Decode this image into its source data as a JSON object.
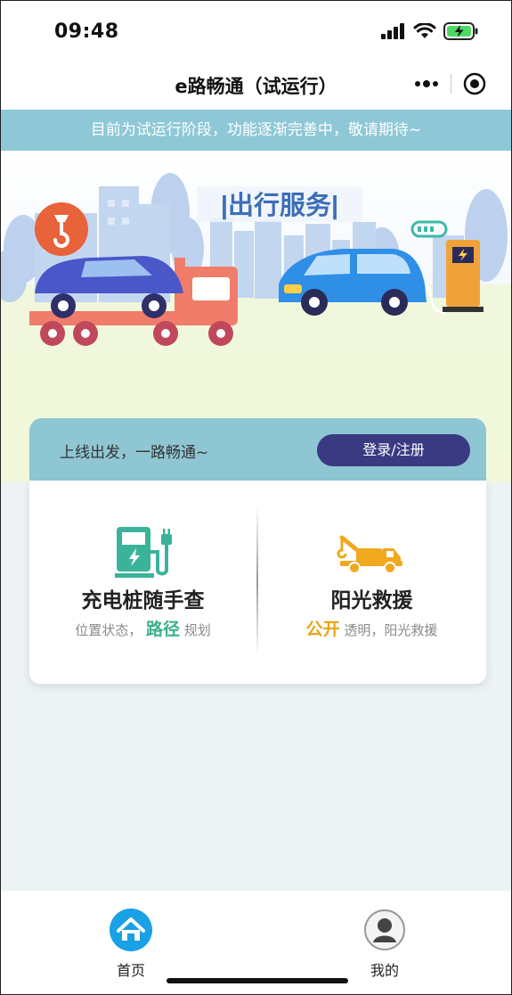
{
  "status": {
    "time": "09:48"
  },
  "nav": {
    "title": "e路畅通（试运行）",
    "more_icon": "more-dots-icon",
    "close_icon": "target-circle-icon"
  },
  "notice": {
    "text": "目前为试运行阶段，功能逐渐完善中，敬请期待~"
  },
  "banner": {
    "title": "|出行服务|"
  },
  "card": {
    "head_text": "上线出发，一路畅通~",
    "login_label": "登录/注册",
    "features": [
      {
        "title": "充电桩随手查",
        "sub_before": "位置状态，",
        "sub_highlight": "路径",
        "sub_after": "规划",
        "highlight_color": "#3ab08a",
        "icon": "charging-station-icon"
      },
      {
        "title": "阳光救援",
        "sub_before": "",
        "sub_highlight": "公开",
        "sub_after": "透明，阳光救援",
        "highlight_color": "#e8a317",
        "icon": "tow-truck-icon"
      }
    ]
  },
  "tabs": [
    {
      "label": "首页",
      "icon": "home-icon",
      "active": true
    },
    {
      "label": "我的",
      "icon": "user-avatar-icon",
      "active": false
    }
  ],
  "colors": {
    "accent": "#1aa0e4",
    "notice_bg": "#8ec8d6",
    "login_bg": "#3a3a82"
  }
}
